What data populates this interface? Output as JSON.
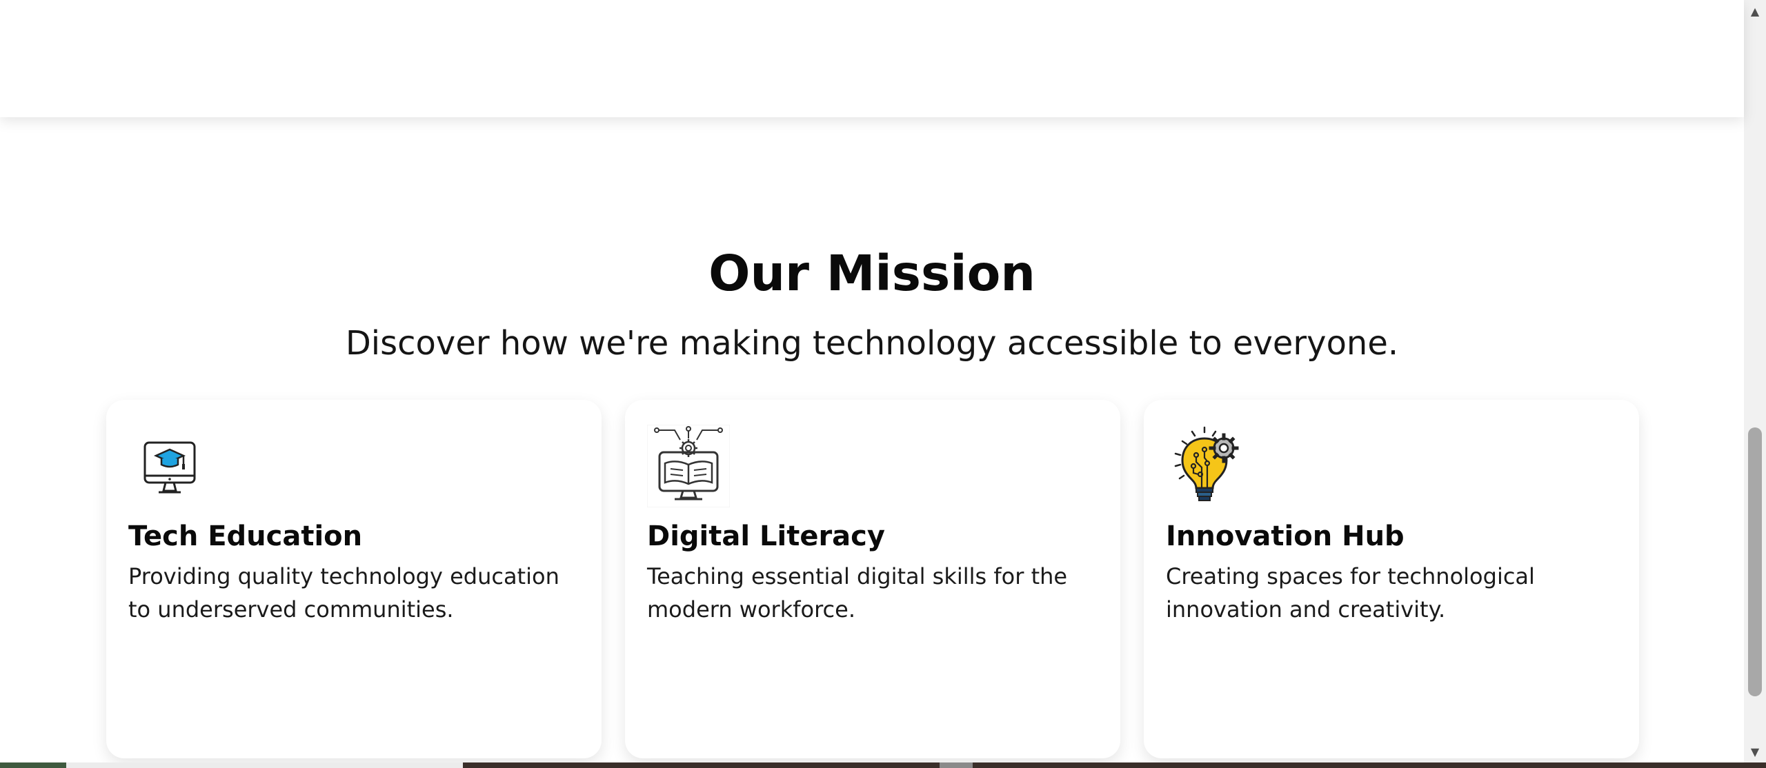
{
  "mission": {
    "title": "Our Mission",
    "subtitle": "Discover how we're making technology accessible to everyone.",
    "cards": [
      {
        "icon": "monitor-graduation-cap-icon",
        "title": "Tech Education",
        "description": "Providing quality technology education to underserved communities."
      },
      {
        "icon": "digital-book-monitor-icon",
        "title": "Digital Literacy",
        "description": "Teaching essential digital skills for the modern workforce."
      },
      {
        "icon": "lightbulb-gear-icon",
        "title": "Innovation Hub",
        "description": "Creating spaces for technological innovation and creativity."
      }
    ]
  },
  "scrollbar": {
    "up_icon": "scroll-up-arrow-icon",
    "down_icon": "scroll-down-arrow-icon"
  },
  "colors": {
    "background": "#ffffff",
    "text": "#111111",
    "icon_blue": "#1fa3e0",
    "icon_yellow": "#f5c518",
    "icon_outline": "#222222"
  }
}
